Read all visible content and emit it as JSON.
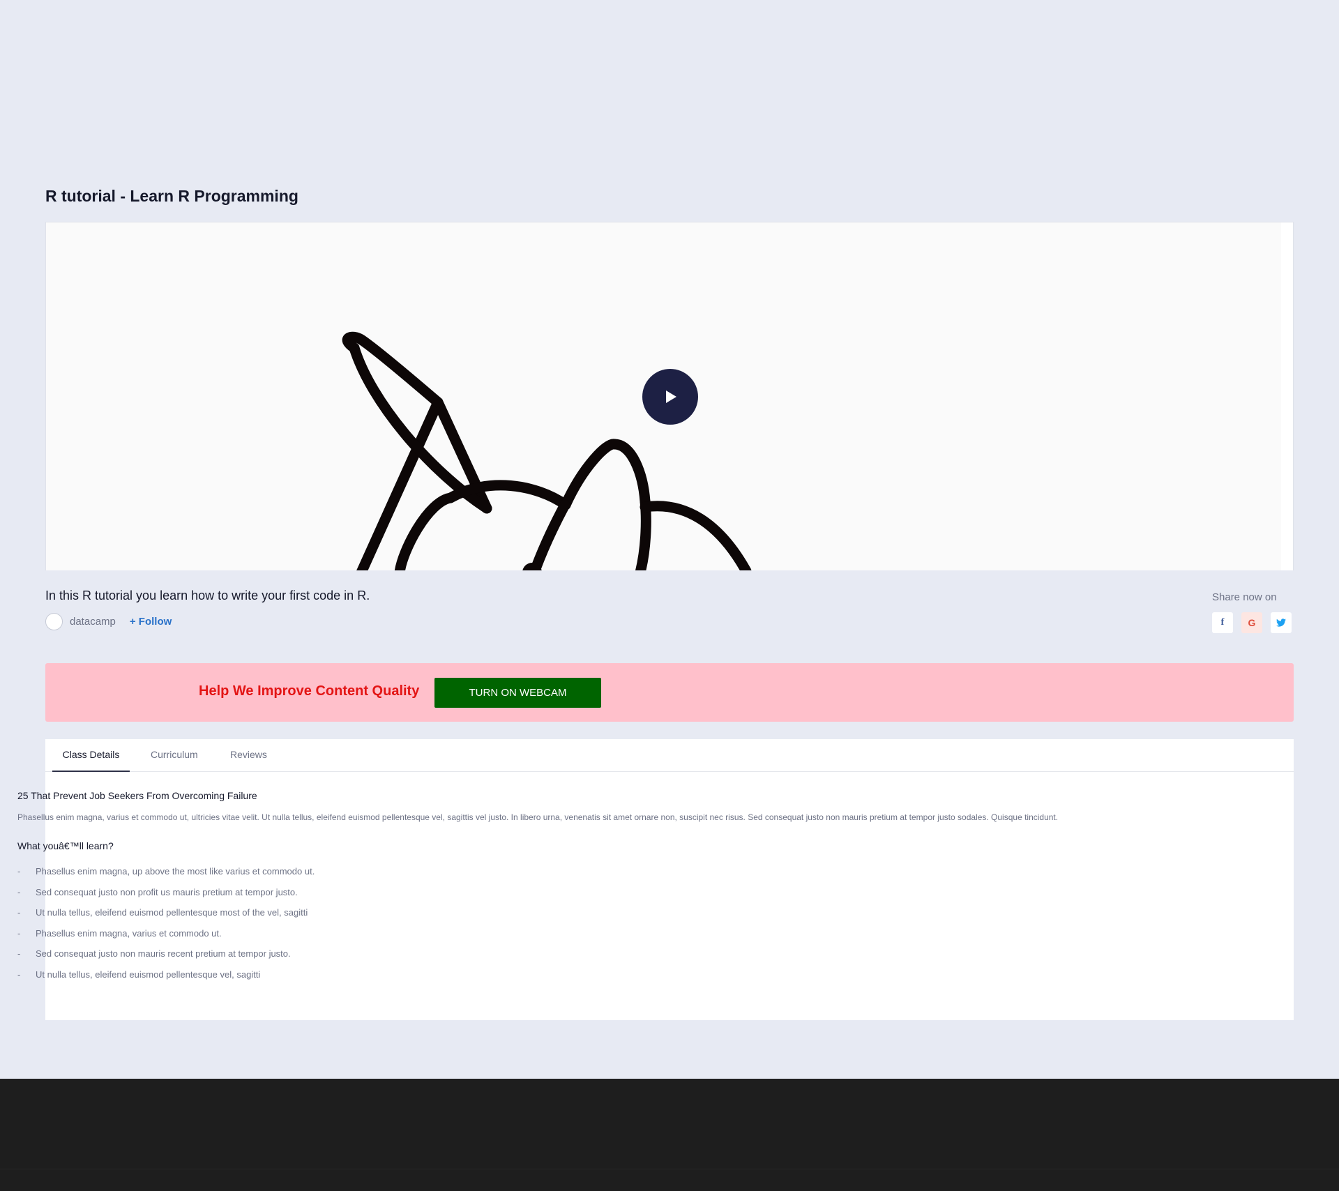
{
  "page": {
    "title": "R tutorial - Learn R Programming",
    "description": "In this R tutorial you learn how to write your first code in R."
  },
  "video": {
    "play_icon": "play-icon"
  },
  "author": {
    "name": "datacamp",
    "follow_label": "+ Follow"
  },
  "share": {
    "label": "Share now on",
    "icons": [
      {
        "name": "facebook-icon",
        "glyph": "f",
        "color": "#3b5998"
      },
      {
        "name": "google-icon",
        "glyph": "G",
        "color": "#dd4b39"
      },
      {
        "name": "twitter-icon",
        "glyph": "🐦",
        "color": "#1da1f2"
      }
    ]
  },
  "banner": {
    "text": "Help We Improve Content Quality",
    "button_label": "TURN ON WEBCAM",
    "background": "#ffc0cb",
    "text_color": "#e31515",
    "button_color": "#006400"
  },
  "tabs": [
    {
      "label": "Class Details",
      "active": true
    },
    {
      "label": "Curriculum",
      "active": false
    },
    {
      "label": "Reviews",
      "active": false
    }
  ],
  "details": {
    "heading": "25 That Prevent Job Seekers From Overcoming Failure",
    "paragraph": "Phasellus enim magna, varius et commodo ut, ultricies vitae velit. Ut nulla tellus, eleifend euismod pellentesque vel, sagittis vel justo. In libero urna, venenatis sit amet ornare non, suscipit nec risus. Sed consequat justo non mauris pretium at tempor justo sodales. Quisque tincidunt.",
    "learn_heading": "What youâ€™ll learn?",
    "bullet": "-",
    "learn_items": [
      "Phasellus enim magna, up above the most like varius et commodo ut.",
      "Sed consequat justo non profit us mauris pretium at tempor justo.",
      "Ut nulla tellus, eleifend euismod pellentesque most of the vel, sagitti",
      "Phasellus enim magna, varius et commodo ut.",
      "Sed consequat justo non mauris recent pretium at tempor justo.",
      "Ut nulla tellus, eleifend euismod pellentesque vel, sagitti"
    ]
  }
}
